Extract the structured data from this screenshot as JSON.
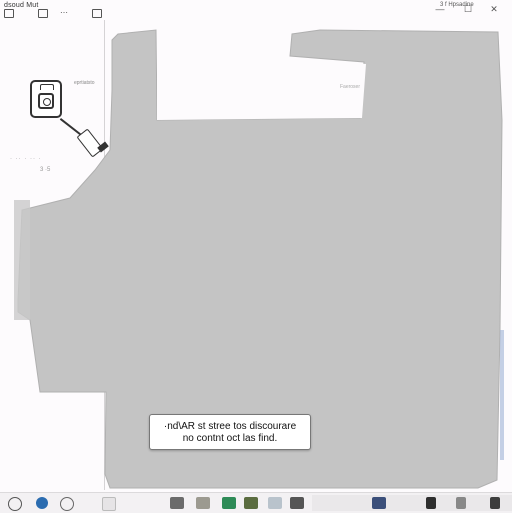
{
  "window": {
    "title": "dsoud Mut",
    "app_label": "3 f Hpsadine",
    "controls": [
      "—",
      "☐",
      "✕"
    ]
  },
  "hints": {
    "top_left": "eprtiatsto",
    "right": "Faeroser",
    "left_row1": "· ·· · ·· ·",
    "left_row2": "3 ·5"
  },
  "dialog": {
    "line1": "·nd\\AR st stree tos discourare",
    "line2": "no contnt oct las find."
  },
  "colors": {
    "shape_fill": "#c4c4c4",
    "dialog_border": "#777777",
    "taskbar": "#f3f1f3"
  },
  "icons": [
    "camera-icon",
    "usb-cable-icon",
    "photos-icon",
    "search-icon",
    "browser-icon",
    "store-icon",
    "folder-icon",
    "mail-icon"
  ]
}
